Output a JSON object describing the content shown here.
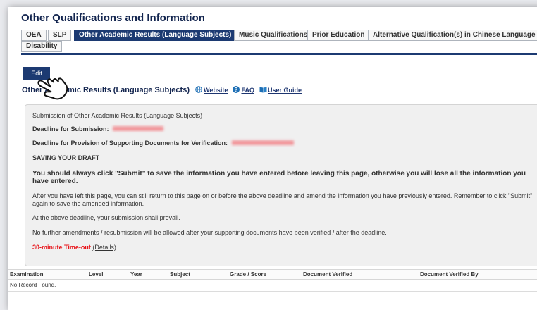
{
  "page": {
    "title": "Other Qualifications and Information"
  },
  "tabs": [
    {
      "label": "OEA",
      "active": false
    },
    {
      "label": "SLP",
      "active": false
    },
    {
      "label": "Other Academic Results (Language Subjects)",
      "active": true
    },
    {
      "label": "Music Qualifications",
      "active": false
    },
    {
      "label": "Prior Education",
      "active": false
    },
    {
      "label": "Alternative Qualification(s) in Chinese Language (ACL)",
      "active": false
    },
    {
      "label": "Disability",
      "active": false
    }
  ],
  "toolbar": {
    "edit_label": "Edit"
  },
  "section": {
    "heading": "Other Academic Results (Language Subjects)",
    "website_label": "Website",
    "faq_label": "FAQ",
    "guide_label": "User Guide"
  },
  "panel": {
    "title": "Submission of Other Academic Results (Language Subjects)",
    "deadline_submission": "Deadline for Submission:",
    "deadline_documents": "Deadline for Provision of Supporting Documents for Verification:",
    "saving_heading": "SAVING YOUR DRAFT",
    "warning": "You should always click \"Submit\" to save the information you have entered before leaving this page, otherwise you will lose all the information you have entered.",
    "return_note": "After you have left this page, you can still return to this page on or before the above deadline and amend the information you have previously entered. Remember to click \"Submit\" again to save the amended information.",
    "prevail_note": "At the above deadline, your submission shall prevail.",
    "no_amend_note": "No further amendments / resubmission will be allowed after your supporting documents have been verified / after the deadline.",
    "timeout_label": "30-minute Time-out",
    "details_label": "(Details)"
  },
  "table": {
    "headers": [
      "Examination",
      "Level",
      "Year",
      "Subject",
      "Grade / Score",
      "Document Verified",
      "Document Verified By"
    ],
    "empty_message": "No Record Found."
  },
  "colors": {
    "navy": "#1c3a72",
    "red": "#e8141a",
    "panel_bg": "#f0f0f0"
  },
  "icons": [
    "globe-icon",
    "help-icon",
    "book-icon",
    "hand-pointer-icon"
  ]
}
